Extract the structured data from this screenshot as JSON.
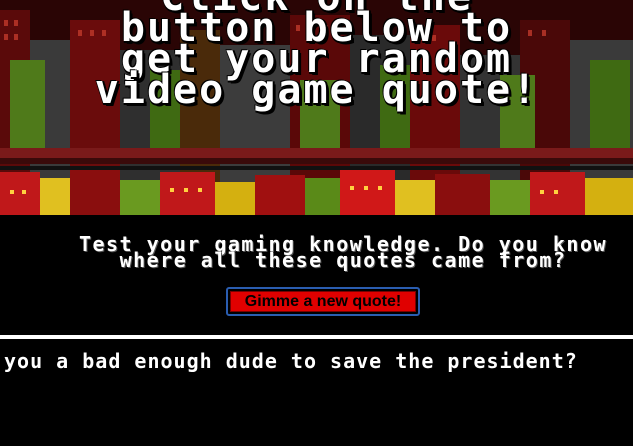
{
  "hero": {
    "title_lines": [
      "Click on the",
      "button below to",
      "get your random",
      "video game quote!"
    ]
  },
  "intro": {
    "line1": "Test your gaming knowledge. Do you know",
    "line2": "where all these quotes came from?"
  },
  "actions": {
    "new_quote_label": "Gimme a new quote!"
  },
  "quote": {
    "text": "you a bad enough dude to save the president?"
  },
  "colors": {
    "background": "#000000",
    "button": "#e00000",
    "button_border": "#2a5db0",
    "text": "#ffffff"
  }
}
